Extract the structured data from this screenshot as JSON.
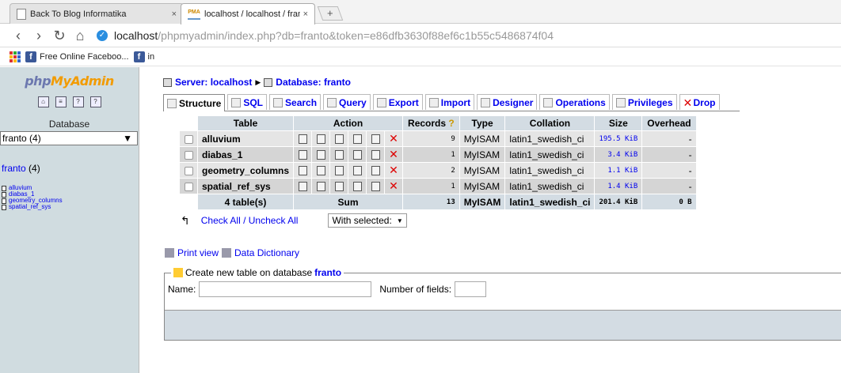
{
  "browser": {
    "tabs": [
      {
        "title": "Back To Blog Informatika",
        "close": "×"
      },
      {
        "title": "localhost / localhost / fran",
        "close": "×"
      }
    ],
    "newtab": "+",
    "url_host": "localhost",
    "url_path": "/phpmyadmin/index.php?db=franto&token=e86dfb3630f88ef6c1b55c5486874f04",
    "bookmarks": [
      {
        "label": "Free Online Faceboo..."
      },
      {
        "label": "in"
      }
    ]
  },
  "sidebar": {
    "logo": {
      "php": "php",
      "my": "My",
      "admin": "Admin"
    },
    "db_label": "Database",
    "db_select": "franto (4)",
    "db_link": "franto",
    "db_count": " (4)",
    "tables": [
      "alluvium",
      "diabas_1",
      "geometry_columns",
      "spatial_ref_sys"
    ]
  },
  "breadcrumb": {
    "server": "Server: localhost",
    "database": "Database: franto",
    "sep": "▶"
  },
  "tabs": [
    "Structure",
    "SQL",
    "Search",
    "Query",
    "Export",
    "Import",
    "Designer",
    "Operations",
    "Privileges",
    "Drop"
  ],
  "table": {
    "headers": [
      "Table",
      "Action",
      "Records",
      "Type",
      "Collation",
      "Size",
      "Overhead"
    ],
    "rows": [
      {
        "name": "alluvium",
        "records": "9",
        "type": "MyISAM",
        "collation": "latin1_swedish_ci",
        "size": "195.5 KiB",
        "overhead": "-"
      },
      {
        "name": "diabas_1",
        "records": "1",
        "type": "MyISAM",
        "collation": "latin1_swedish_ci",
        "size": "3.4 KiB",
        "overhead": "-"
      },
      {
        "name": "geometry_columns",
        "records": "2",
        "type": "MyISAM",
        "collation": "latin1_swedish_ci",
        "size": "1.1 KiB",
        "overhead": "-"
      },
      {
        "name": "spatial_ref_sys",
        "records": "1",
        "type": "MyISAM",
        "collation": "latin1_swedish_ci",
        "size": "1.4 KiB",
        "overhead": "-"
      }
    ],
    "summary": {
      "tables": "4 table(s)",
      "sum": "Sum",
      "records": "13",
      "type": "MyISAM",
      "collation": "latin1_swedish_ci",
      "size": "201.4 KiB",
      "overhead": "0 B"
    },
    "delete_glyph": "✕"
  },
  "checkall": {
    "label": "Check All / Uncheck All",
    "with_selected": "With selected:",
    "arrow": "↰"
  },
  "links": {
    "print": "Print view",
    "dictionary": "Data Dictionary"
  },
  "create": {
    "legend": "Create new table on database",
    "db": "franto",
    "name_label": "Name:",
    "fields_label": "Number of fields:"
  }
}
